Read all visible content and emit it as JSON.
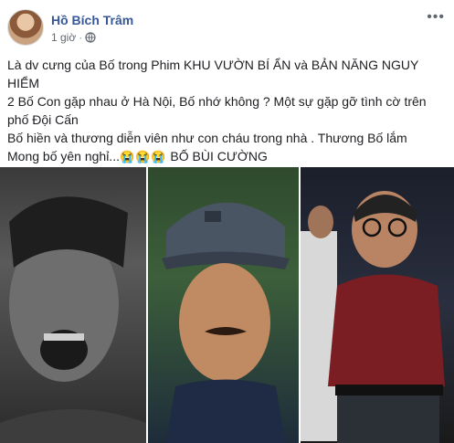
{
  "post": {
    "author": "Hồ Bích Trâm",
    "time": "1 giờ",
    "separator": "·",
    "more_icon": "ellipsis-icon",
    "privacy_icon": "globe-icon",
    "lines": [
      "Là dv cưng của Bố trong Phim KHU VƯỜN BÍ ẨN và BẢN NĂNG NGUY HIỂM",
      "2 Bố Con gặp nhau ở Hà Nội, Bố nhớ không ? Một sự gặp gỡ tình cờ trên phố Đội Cấn",
      "Bố hiền và thương diễn viên như con cháu trong nhà . Thương Bố lắm"
    ],
    "last_line_prefix": "Mong bố yên nghỉ...",
    "emojis": [
      "😭",
      "😭",
      "😭"
    ],
    "last_line_suffix": " BỐ BÙI CƯỜNG"
  }
}
